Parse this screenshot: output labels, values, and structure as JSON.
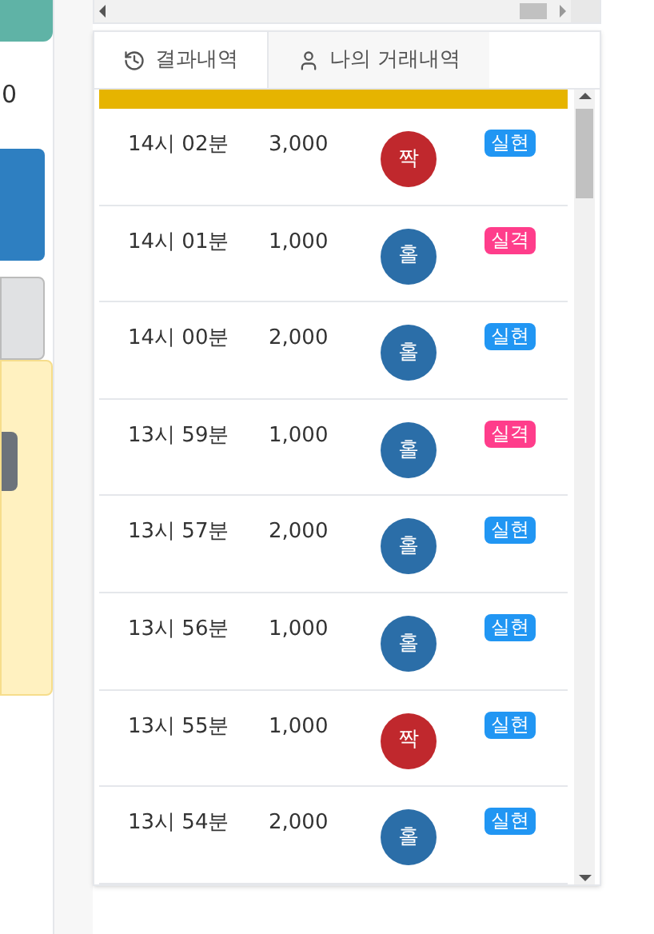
{
  "left_panel": {
    "value": "0"
  },
  "tabs": [
    {
      "label": "결과내역",
      "selected": true
    },
    {
      "label": "나의 거래내역",
      "selected": false
    }
  ],
  "rows": [
    {
      "time": "14시 02분",
      "amount": "3,000",
      "result": {
        "text": "짝",
        "color": "#c0282d"
      },
      "status": {
        "text": "실현",
        "color": "#2196f3"
      }
    },
    {
      "time": "14시 01분",
      "amount": "1,000",
      "result": {
        "text": "홀",
        "color": "#2b6ea8"
      },
      "status": {
        "text": "실격",
        "color": "#ff3d8b"
      }
    },
    {
      "time": "14시 00분",
      "amount": "2,000",
      "result": {
        "text": "홀",
        "color": "#2b6ea8"
      },
      "status": {
        "text": "실현",
        "color": "#2196f3"
      }
    },
    {
      "time": "13시 59분",
      "amount": "1,000",
      "result": {
        "text": "홀",
        "color": "#2b6ea8"
      },
      "status": {
        "text": "실격",
        "color": "#ff3d8b"
      }
    },
    {
      "time": "13시 57분",
      "amount": "2,000",
      "result": {
        "text": "홀",
        "color": "#2b6ea8"
      },
      "status": {
        "text": "실현",
        "color": "#2196f3"
      }
    },
    {
      "time": "13시 56분",
      "amount": "1,000",
      "result": {
        "text": "홀",
        "color": "#2b6ea8"
      },
      "status": {
        "text": "실현",
        "color": "#2196f3"
      }
    },
    {
      "time": "13시 55분",
      "amount": "1,000",
      "result": {
        "text": "짝",
        "color": "#c0282d"
      },
      "status": {
        "text": "실현",
        "color": "#2196f3"
      }
    },
    {
      "time": "13시 54분",
      "amount": "2,000",
      "result": {
        "text": "홀",
        "color": "#2b6ea8"
      },
      "status": {
        "text": "실현",
        "color": "#2196f3"
      }
    }
  ]
}
